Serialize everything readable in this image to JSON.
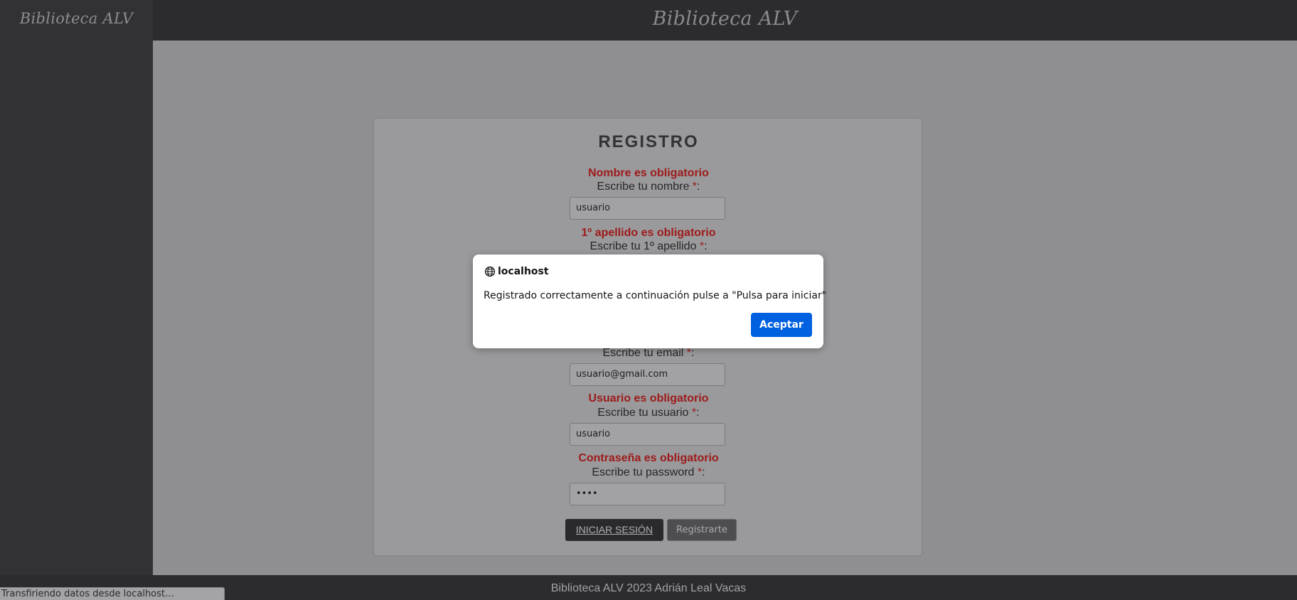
{
  "app": {
    "sidebar_logo": "Biblioteca ALV",
    "header_title": "Biblioteca ALV"
  },
  "form": {
    "title": "REGISTRO",
    "required_mark": "*",
    "name": {
      "error": "Nombre es obligatorio",
      "label": "Escribe tu nombre ",
      "value": "usuario"
    },
    "surname1": {
      "error": "1º apellido es obligatorio",
      "label": "Escribe tu 1º apellido "
    },
    "email": {
      "label": "Escribe tu email ",
      "value": "usuario@gmail.com"
    },
    "username": {
      "error": "Usuario es obligatorio",
      "label": "Escribe tu usuario ",
      "value": "usuario"
    },
    "password": {
      "error": "Contraseña es obligatorio",
      "label": "Escribe tu password ",
      "value": "••••"
    },
    "login_button": "INICIAR SESIÓN",
    "register_button": "Registrarte"
  },
  "footer": {
    "text": "Biblioteca ALV 2023 Adrián Leal Vacas"
  },
  "status_bar": {
    "text": "Transfiriendo datos desde localhost…"
  },
  "dialog": {
    "icon": "globe-icon",
    "origin": "localhost",
    "message": "Registrado correctamente a continuación pulse a \"Pulsa para iniciar\"",
    "ok_button": "Aceptar"
  },
  "colors": {
    "error": "#9e1a1a",
    "dialog_button": "#0061e0",
    "sidebar": "#323234",
    "header": "#2c2c2e"
  }
}
